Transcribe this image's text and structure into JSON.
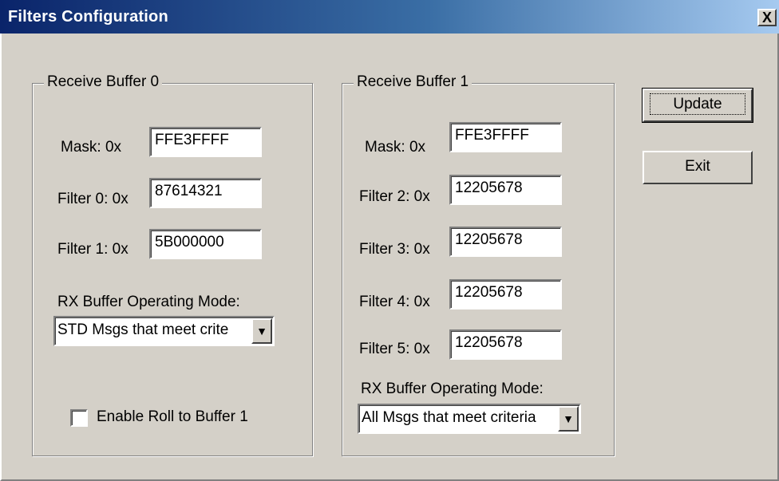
{
  "window": {
    "title": "Filters Configuration",
    "close_glyph": "X"
  },
  "buffer0": {
    "group_label": "Receive Buffer 0",
    "mask_label": "Mask:  0x",
    "mask_value": "FFE3FFFF",
    "filter0_label": "Filter 0: 0x",
    "filter0_value": "87614321",
    "filter1_label": "Filter 1: 0x",
    "filter1_value": "5B000000",
    "mode_label": "RX Buffer Operating Mode:",
    "mode_value": "STD Msgs that meet crite",
    "roll_label": "Enable Roll to Buffer 1",
    "roll_checked": false
  },
  "buffer1": {
    "group_label": "Receive Buffer 1",
    "mask_label": "Mask:  0x",
    "mask_value": "FFE3FFFF",
    "filter2_label": "Filter 2: 0x",
    "filter2_value": "12205678",
    "filter3_label": "Filter 3: 0x",
    "filter3_value": "12205678",
    "filter4_label": "Filter 4: 0x",
    "filter4_value": "12205678",
    "filter5_label": "Filter 5: 0x",
    "filter5_value": "12205678",
    "mode_label": "RX Buffer Operating Mode:",
    "mode_value": "All Msgs that meet criteria"
  },
  "buttons": {
    "update_label": "Update",
    "exit_label": "Exit"
  },
  "icons": {
    "dropdown_arrow": "chevron-down-icon",
    "close": "close-icon"
  }
}
